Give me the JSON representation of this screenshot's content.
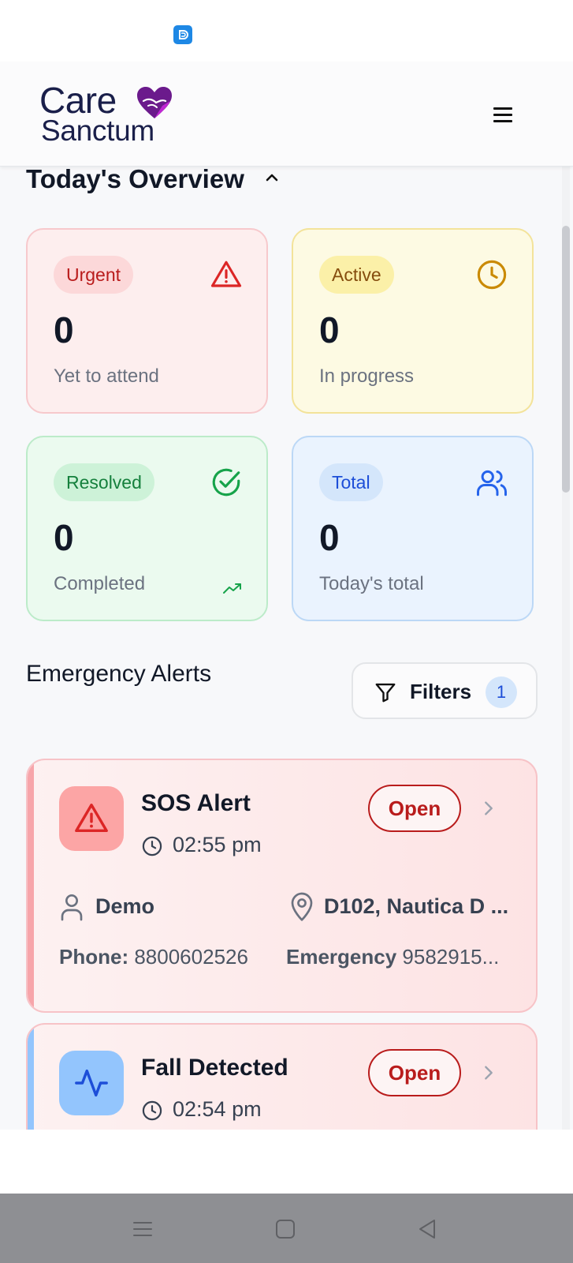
{
  "app": {
    "brand_line1": "Care",
    "brand_line2": "Sanctum",
    "brand_color": "#1a1f4a",
    "heart_color": "#7c1fa0"
  },
  "overview": {
    "title": "Today's Overview",
    "cards": {
      "urgent": {
        "badge": "Urgent",
        "count": "0",
        "label": "Yet to attend",
        "icon": "alert-triangle-icon",
        "color": "#dc2626"
      },
      "active": {
        "badge": "Active",
        "count": "0",
        "label": "In progress",
        "icon": "clock-icon",
        "color": "#ca8a04"
      },
      "resolved": {
        "badge": "Resolved",
        "count": "0",
        "label": "Completed",
        "icon": "check-circle-icon",
        "color": "#16a34a"
      },
      "total": {
        "badge": "Total",
        "count": "0",
        "label": "Today's total",
        "icon": "users-icon",
        "color": "#2563eb"
      }
    }
  },
  "alerts": {
    "title": "Emergency Alerts",
    "filters_label": "Filters",
    "filters_count": "1",
    "items": [
      {
        "title": "SOS Alert",
        "time": "02:55 pm",
        "status": "Open",
        "icon": "alert-triangle-icon",
        "user": "Demo",
        "location": "D102, Nautica D ...",
        "phone_label": "Phone:",
        "phone": "8800602526",
        "emergency_label": "Emergency",
        "emergency": "9582915..."
      },
      {
        "title": "Fall Detected",
        "time": "02:54 pm",
        "status": "Open",
        "icon": "activity-icon"
      }
    ]
  }
}
